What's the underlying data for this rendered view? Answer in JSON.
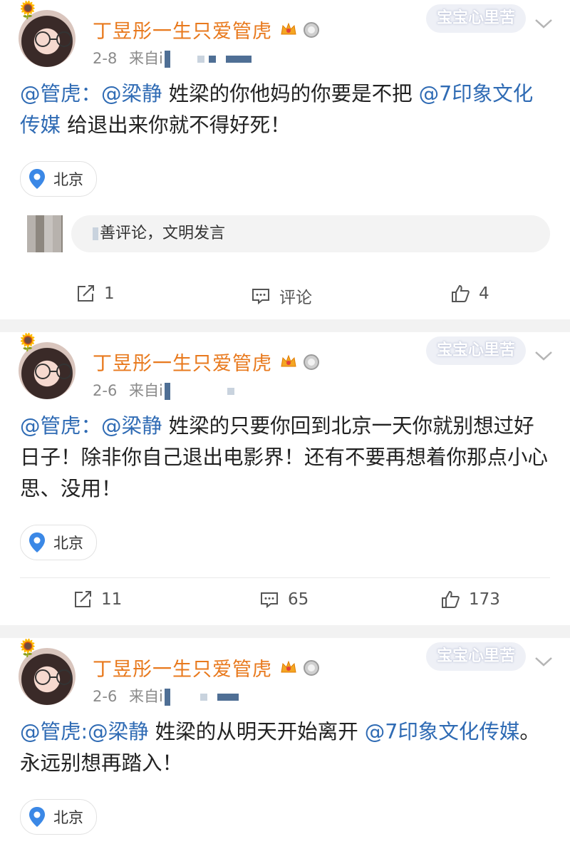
{
  "posts": [
    {
      "username": "丁昱彤一生只爱管虎",
      "date": "2-8",
      "source_prefix": "来自i",
      "watermark": "宝宝心里苦",
      "content": {
        "mention1": "@管虎",
        "sep": "：",
        "mention2": "@梁静",
        "text1": " 姓梁的你他妈的你要是不把 ",
        "mention3": "@7印象文化传媒",
        "text2": " 给退出来你就不得好死！"
      },
      "location": "北京",
      "comment_placeholder": "善评论，文明发言",
      "actions": {
        "repost": "1",
        "comment": "评论",
        "like": "4"
      }
    },
    {
      "username": "丁昱彤一生只爱管虎",
      "date": "2-6",
      "source_prefix": "来自i",
      "watermark": "宝宝心里苦",
      "content": {
        "mention1": "@管虎",
        "sep": "：",
        "mention2": "@梁静",
        "text1": " 姓梁的只要你回到北京一天你就别想过好日子！除非你自己退出电影界！还有不要再想着你那点小心思、没用！",
        "mention3": "",
        "text2": ""
      },
      "location": "北京",
      "actions": {
        "repost": "11",
        "comment": "65",
        "like": "173"
      }
    },
    {
      "username": "丁昱彤一生只爱管虎",
      "date": "2-6",
      "source_prefix": "来自i",
      "watermark": "宝宝心里苦",
      "content": {
        "mention1": "@管虎",
        "sep": ":",
        "mention2": "@梁静",
        "text1": " 姓梁的从明天开始离开 ",
        "mention3": "@7印象文化传媒",
        "text2": "。 永远别想再踏入！"
      },
      "location": "北京"
    }
  ],
  "colors": {
    "username": "#e8791d",
    "mention": "#2f6bb4",
    "meta": "#8a8a8a"
  }
}
